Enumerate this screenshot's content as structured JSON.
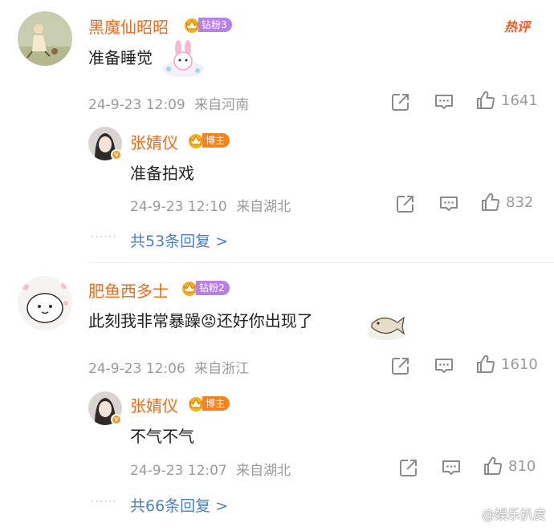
{
  "hot_label": "热评",
  "comments": [
    {
      "user": "黑魔仙昭昭",
      "badge": "钻粉3",
      "text": "准备睡觉",
      "time": "24-9-23 12:09",
      "location": "来自河南",
      "likes": "1641",
      "sticker": "pink-bunny-sticker",
      "reply": {
        "user": "张婧仪",
        "badge": "博主",
        "text": "准备拍戏",
        "time": "24-9-23 12:10",
        "location": "来自湖北",
        "likes": "832"
      },
      "more": "共53条回复 >"
    },
    {
      "user": "肥鱼西多士",
      "badge": "钻粉2",
      "text": "此刻我非常暴躁",
      "emoji": "😡",
      "text2": "还好你出现了",
      "time": "24-9-23 12:06",
      "location": "来自浙江",
      "likes": "1610",
      "sticker": "fish-sticker",
      "reply": {
        "user": "张婧仪",
        "badge": "博主",
        "text": "不气不气",
        "time": "24-9-23 12:07",
        "location": "来自湖北",
        "likes": "810"
      },
      "more": "共66条回复 >"
    }
  ],
  "watermark": "@娱乐扒皮",
  "colors": {
    "name": "#eb6c1b",
    "link": "#4a7fc1",
    "meta": "#9a9a9a",
    "fan_badge": "#b87fe8",
    "host_badge": "#f5821f"
  },
  "icons": {
    "share": "share-icon",
    "comment": "comment-icon",
    "like": "like-icon"
  }
}
